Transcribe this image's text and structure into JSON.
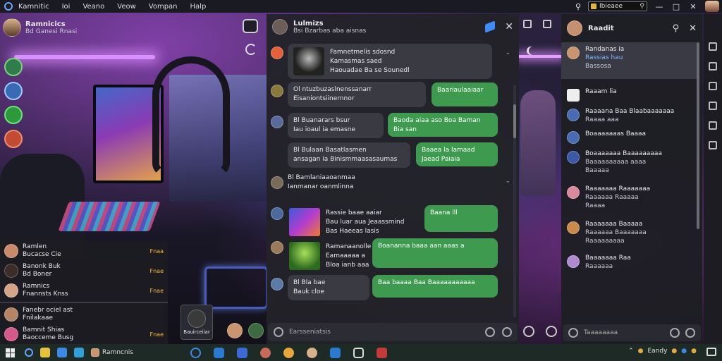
{
  "menubar": {
    "items": [
      "Kamnitic",
      "Ioi",
      "Veano",
      "Veow",
      "Vompan",
      "Halp"
    ],
    "search_value": "Ibieaee",
    "window_controls": [
      "—",
      "□",
      "✕"
    ]
  },
  "left": {
    "user_name": "Ramnicics",
    "user_sub": "Bd Ganesi Rnasi",
    "mini_list": [
      {
        "name": "Ramlen",
        "sub": "Bucacse Cie",
        "meta": "Fnaa"
      },
      {
        "name": "Banonk Buk",
        "sub": "Bd Boner",
        "meta": "Fnae"
      },
      {
        "name": "Ramnics",
        "sub": "Fnannsts Knss",
        "meta": "Fnae"
      },
      {
        "name": "Fanebr ociel ast",
        "sub": "Fnilakaae",
        "meta": ""
      },
      {
        "name": "Bamnit Shias",
        "sub": "Baocceme Busg",
        "meta": "Fnae"
      }
    ],
    "tile_label": "Bauirceiiar"
  },
  "chat": {
    "title": "Lulmizs",
    "subtitle": "Bsi Bzarbas aba aisnas",
    "messages": [
      {
        "l1": "Famnetmelis sdosnd",
        "l2": "Kamasmas saed",
        "l3": "Haouadae Ba se Sounedl"
      },
      {
        "l1": "Ol ntuzbuzaslnenssanarr",
        "l2": "Eisaniontsiinernnor"
      },
      {
        "l1": "Bl Buanarars bsur",
        "l2": "Iau ioaul ia emasne"
      },
      {
        "l1": "Bl Bulaan Basatlasmen",
        "l2": "ansagan ia Binismmaasasaumas"
      },
      {
        "l1": "Bl Bamlaniaaoanmaa",
        "l2": "Ianmanar oanmlinna"
      },
      {
        "l1": "Rassie baae aaiar",
        "l2": "Bau luar aua Jeaassmind",
        "l3": "Bas Haeeas lasis"
      },
      {
        "l1": "Ramanaanolle",
        "l2": "Eamaaaaa a",
        "l3": "Bloa ianb aaa"
      },
      {
        "l1": "Bl Bla bae",
        "l2": "Bauk cloe"
      }
    ],
    "greens": [
      "Baariaulaaiaar",
      "Baoda aiaa aso Boa Baman Bia san",
      "Baaea la lamaad Jaead Paiaia",
      "Baana lll",
      "Boananna baaa aan aaas a",
      "Baa baaaa Baa Baaaaaaaaaaa"
    ],
    "input_placeholder": "Earsseniatsis"
  },
  "right": {
    "title": "Raadit",
    "items": [
      {
        "name": "Randanas ia",
        "sub": "Rassias hau",
        "sub2": "Bassosa"
      },
      {
        "name": "Raaam lia",
        "sub": ""
      },
      {
        "name": "Raaaana Baa Blaabaaaaaaa",
        "sub": "Raaaa aaa"
      },
      {
        "name": "Boaaaaaaas Baaaa",
        "sub": ""
      },
      {
        "name": "Boaaaaaaa Baaaaaaaaa",
        "sub": "Baaaaaaaaaa aaaa",
        "sub2": "Baaaaa"
      },
      {
        "name": "Raaaaaaa Raaaaaaa",
        "sub": "Raaaaaa Raaaaa",
        "sub2": "Raaaa"
      },
      {
        "name": "Raaaaaaa Baaaaa",
        "sub": "Raaaaaa Baaaaaaa",
        "sub2": "Raaaaaaaaa"
      },
      {
        "name": "Baaaaaaa Raa",
        "sub": "Raaaaaa"
      }
    ],
    "input_placeholder": "Taaaaaaaa"
  },
  "taskbar": {
    "app_label": "Ramncnis",
    "tray_text": "Eandy",
    "colors": {
      "bg": "#1d2a26",
      "accent": "#3d9a4f"
    }
  }
}
